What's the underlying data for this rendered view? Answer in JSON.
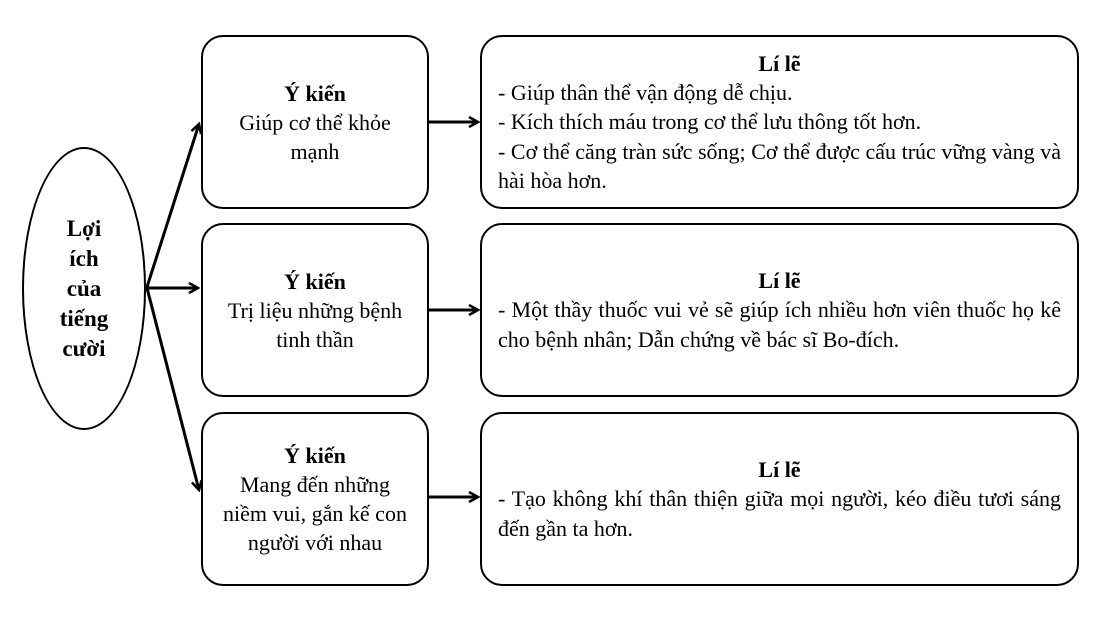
{
  "center": {
    "lines": [
      "Lợi",
      "ích",
      "của",
      "tiếng",
      "cười"
    ]
  },
  "rows": [
    {
      "opinion": {
        "heading": "Ý kiến",
        "text": "Giúp cơ thể khỏe mạnh"
      },
      "reason": {
        "heading": "Lí lẽ",
        "lines": [
          "- Giúp thân thể vận động dễ chịu.",
          "- Kích thích máu trong cơ thể lưu thông tốt hơn.",
          "- Cơ thể căng tràn sức sống; Cơ thể được cấu trúc vững vàng và hài hòa hơn."
        ]
      }
    },
    {
      "opinion": {
        "heading": "Ý kiến",
        "text": "Trị liệu những bệnh tinh thần"
      },
      "reason": {
        "heading": "Lí lẽ",
        "lines": [
          "- Một thầy thuốc vui vẻ sẽ giúp ích nhiều hơn viên thuốc họ kê cho bệnh nhân; Dẫn chứng về bác sĩ Bo-đích."
        ]
      }
    },
    {
      "opinion": {
        "heading": "Ý kiến",
        "text": "Mang đến những niềm vui, gắn kế con người với nhau"
      },
      "reason": {
        "heading": "Lí lẽ",
        "lines": [
          "- Tạo không khí thân thiện giữa mọi người, kéo điều tươi sáng đến gần ta hơn."
        ]
      }
    }
  ]
}
